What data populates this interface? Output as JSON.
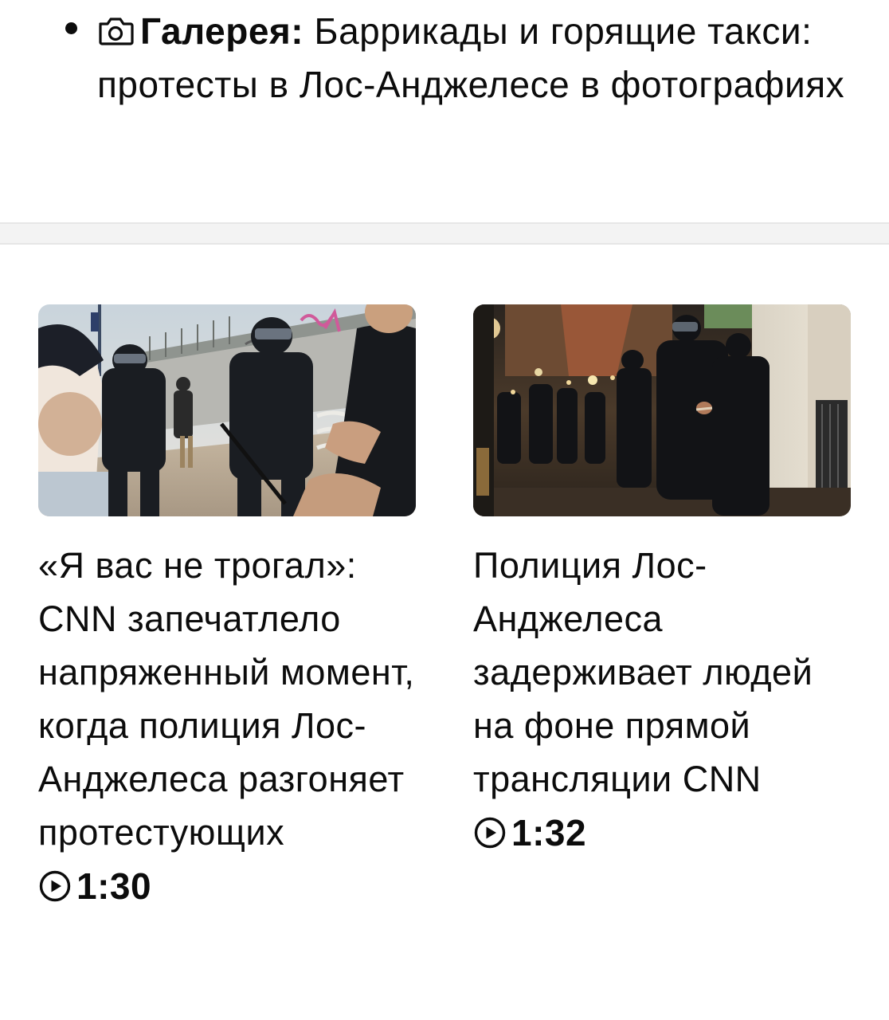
{
  "gallery": {
    "icon": "camera-icon",
    "label": "Галерея:",
    "headline": "Баррикады и горящие такси: протесты в Лос-Анджелесе в фотографиях"
  },
  "videos": [
    {
      "title": "«Я вас не трогал»: CNN запечатлело напряженный момент, когда полиция Лос-Анджелеса разгоняет протестующих",
      "duration": "1:30",
      "duration_icon": "play-circle-icon"
    },
    {
      "title": "Полиция Лос-Анджелеса задерживает людей на фоне прямой трансляции CNN",
      "duration": "1:32",
      "duration_icon": "play-circle-icon"
    }
  ],
  "colors": {
    "text": "#0c0c0c",
    "divider": "#f3f3f3"
  }
}
